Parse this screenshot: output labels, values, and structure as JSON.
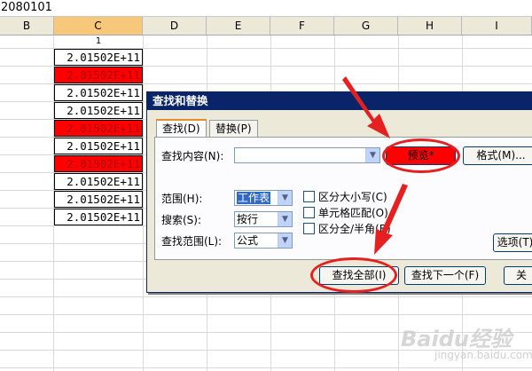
{
  "formula_bar": {
    "text": "2080101"
  },
  "columns": [
    {
      "label": "B"
    },
    {
      "label": "C"
    },
    {
      "label": "D"
    },
    {
      "label": "E"
    },
    {
      "label": "F"
    },
    {
      "label": "G"
    },
    {
      "label": "H"
    },
    {
      "label": "I"
    }
  ],
  "sheet": {
    "c1_label": "1",
    "cells": [
      {
        "value": "2.01502E+11",
        "highlighted": false
      },
      {
        "value": "2.01502E+11",
        "highlighted": true
      },
      {
        "value": "2.01502E+11",
        "highlighted": false
      },
      {
        "value": "2.01502E+11",
        "highlighted": false
      },
      {
        "value": "2.01502E+11",
        "highlighted": true
      },
      {
        "value": "2.01502E+11",
        "highlighted": false
      },
      {
        "value": "2.01502E+11",
        "highlighted": true
      },
      {
        "value": "2.01502E+11",
        "highlighted": false
      },
      {
        "value": "2.01502E+11",
        "highlighted": false
      },
      {
        "value": "2.01502E+11",
        "highlighted": false
      }
    ],
    "highlight_color": "#ff0000"
  },
  "dialog": {
    "title": "查找和替换",
    "tabs": [
      {
        "label": "查找(D)"
      },
      {
        "label": "替换(P)"
      }
    ],
    "find_label": "查找内容(N):",
    "find_value": "",
    "preview_label": "预览*",
    "format_button": "格式(M)...",
    "scope_label": "范围(H):",
    "scope_value": "工作表",
    "search_label": "搜索(S):",
    "search_value": "按行",
    "lookin_label": "查找范围(L):",
    "lookin_value": "公式",
    "match_case": "区分大小写(C)",
    "match_cell": "单元格匹配(O)",
    "match_width": "区分全/半角(B)",
    "options_button": "选项(T)",
    "find_all_button": "查找全部(I)",
    "find_next_button": "查找下一个(F)",
    "close_button": "关"
  },
  "annotation_color": "#e62020",
  "watermark": {
    "text": "Baidu经验",
    "sub": "jingyan.baidu.com"
  }
}
